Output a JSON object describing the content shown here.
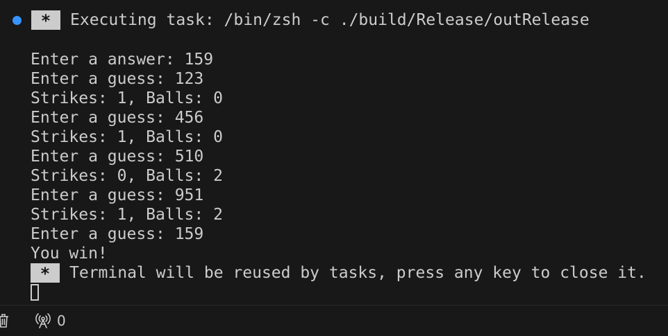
{
  "task": {
    "badge": "*",
    "title": "Executing task: /bin/zsh -c ./build/Release/outRelease"
  },
  "output_lines": [
    "Enter a answer: 159",
    "Enter a guess: 123",
    "Strikes: 1, Balls: 0",
    "Enter a guess: 456",
    "Strikes: 1, Balls: 0",
    "Enter a guess: 510",
    "Strikes: 0, Balls: 2",
    "Enter a guess: 951",
    "Strikes: 1, Balls: 2",
    "Enter a guess: 159",
    "You win!"
  ],
  "reuse_message": {
    "badge": "*",
    "text": "Terminal will be reused by tasks, press any key to close it."
  },
  "status_bar": {
    "trash_icon": "trash-icon",
    "broadcast_icon": "broadcast-icon",
    "ports_count": "0"
  },
  "colors": {
    "background": "#181818",
    "foreground": "#cccccc",
    "task_dot": "#3794ff"
  }
}
